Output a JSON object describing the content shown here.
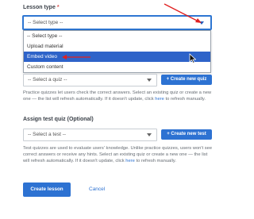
{
  "lesson_type": {
    "label": "Lesson type",
    "required_mark": "*",
    "selected": "-- Select type --",
    "options": [
      "-- Select type --",
      "Upload material",
      "Embed video",
      "Custom content"
    ],
    "highlighted_index": 2
  },
  "practice_quiz": {
    "select_placeholder": "-- Select a quiz --",
    "create_button": "+ Create new quiz",
    "help_before": "Practice quizzes let users check the correct answers. Select an existing quiz or create a new one — the list will refresh automatically. If it doesn't update, click ",
    "help_link": "here",
    "help_after": " to refresh manually."
  },
  "test_quiz": {
    "label": "Assign test quiz (Optional)",
    "select_placeholder": "-- Select a test --",
    "create_button": "+ Create new test",
    "help_before": "Test quizzes are used to evaluate users' knowledge. Unlike practice quizzes, users won't see correct answers or receive any hints. Select an existing quiz or create a new one — the list will refresh automatically. If it doesn't update, click ",
    "help_link": "here",
    "help_after": " to refresh manually."
  },
  "actions": {
    "create_label": "Create lesson",
    "cancel_label": "Cancel"
  },
  "colors": {
    "accent": "#2d72d2",
    "annotation_arrow": "#e02020",
    "highlight": "#2e63c9"
  }
}
